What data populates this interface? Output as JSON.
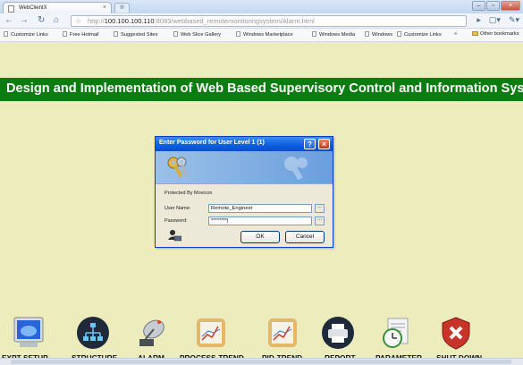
{
  "browser": {
    "tab_title": "WebClientX",
    "tab_close": "×",
    "new_tab": "⊕",
    "url_prefix": "http://",
    "url_host": "100.100.100.110",
    "url_rest": ":8083/webbased_remotemonitoringsystem/Alarm.html",
    "window_controls": [
      "–",
      "▫",
      "×"
    ]
  },
  "bookmarks": [
    "Customize Links",
    "Free Hotmail",
    "Suggested Sites",
    "Web Slice Gallery",
    "Windows Marketplace",
    "Windows Media",
    "Windows",
    "Customize Links"
  ],
  "bookmarks_overflow": "»",
  "other_bookmarks": "Other bookmarks",
  "page": {
    "title": "Design and Implementation of Web Based Supervisory Control and Information System"
  },
  "dialog": {
    "title": "Enter Password for User Level 1 (1)",
    "help": "?",
    "close": "×",
    "protected_by": "Protected By Movicon",
    "username_label": "User Name:",
    "username_value": "Remote_Engineer",
    "password_label": "Password:",
    "password_value": "********|",
    "ellipsis": "...",
    "ok_label": "OK",
    "cancel_label": "Cancel"
  },
  "toolbar": [
    {
      "label": "EXPT-SETUP",
      "icon": "monitor-icon"
    },
    {
      "label": "STRUCTURE",
      "icon": "network-structure-icon"
    },
    {
      "label": "ALARM",
      "icon": "alarm-satellite-icon"
    },
    {
      "label": "PROCESS-TREND",
      "icon": "trend-chart-icon"
    },
    {
      "label": "PID-TREND",
      "icon": "trend-chart-icon"
    },
    {
      "label": "REPORT",
      "icon": "printer-icon"
    },
    {
      "label": "PARAMETER",
      "icon": "clock-document-icon"
    },
    {
      "label": "SHUT DOWN",
      "icon": "shield-shutdown-icon"
    }
  ],
  "colors": {
    "page_bg": "#ececbd",
    "banner_bg": "#0b7d10",
    "banner_text": "#ffffff",
    "dialog_title": "#0a5ddc"
  }
}
